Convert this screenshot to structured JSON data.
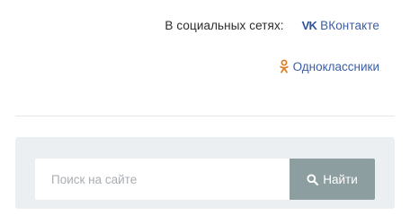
{
  "social": {
    "label": "В социальных сетях:",
    "vk": {
      "icon": "vk-logo-icon",
      "label": "ВКонтакте"
    },
    "ok": {
      "icon": "odnoklassniki-icon",
      "label": "Одноклассники"
    }
  },
  "search": {
    "placeholder": "Поиск на сайте",
    "value": "",
    "button_label": "Найти",
    "button_icon": "search-icon"
  },
  "colors": {
    "link": "#3b5ea6",
    "button_bg": "#8c9ea0",
    "panel_bg": "#eceff1"
  }
}
